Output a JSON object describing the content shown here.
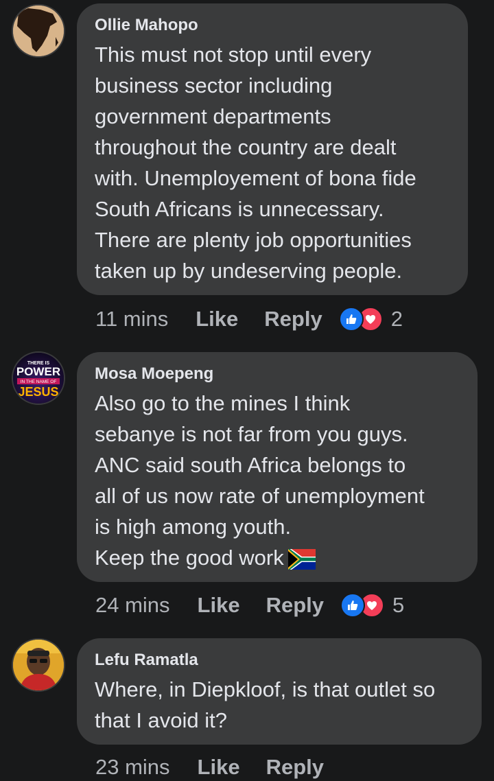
{
  "comments": [
    {
      "author": "Ollie Mahopo",
      "text": "This must not stop until every\nbusiness sector including\ngovernment departments\nthroughout the country are dealt\nwith. Unemployement of bona fide\nSouth Africans is unnecessary.\nThere are plenty job opportunities\ntaken up by undeserving people.",
      "time": "11 mins",
      "like_label": "Like",
      "reply_label": "Reply",
      "reaction_count": "2",
      "reactions": [
        "like-icon",
        "love-icon"
      ]
    },
    {
      "author": "Mosa Moepeng",
      "avatar_text": [
        "THERE IS",
        "POWER",
        "IN THE NAME OF",
        "JESUS"
      ],
      "text": "Also go to the mines I think\nsebanye is not far from you guys.\nANC said south Africa belongs to\nall of us now rate of unemployment\nis high among youth.\nKeep the good work",
      "time": "24 mins",
      "like_label": "Like",
      "reply_label": "Reply",
      "reaction_count": "5",
      "reactions": [
        "like-icon",
        "love-icon"
      ]
    },
    {
      "author": "Lefu Ramatla",
      "text": "Where, in Diepkloof, is that outlet so\nthat I avoid it?",
      "time": "23 mins",
      "like_label": "Like",
      "reply_label": "Reply"
    }
  ],
  "colors": {
    "background": "#18191a",
    "bubble": "#3a3b3c",
    "text": "#e4e6eb",
    "secondary_text": "#b0b3b8",
    "like_blue": "#1877f2",
    "love_red": "#f33e58"
  }
}
